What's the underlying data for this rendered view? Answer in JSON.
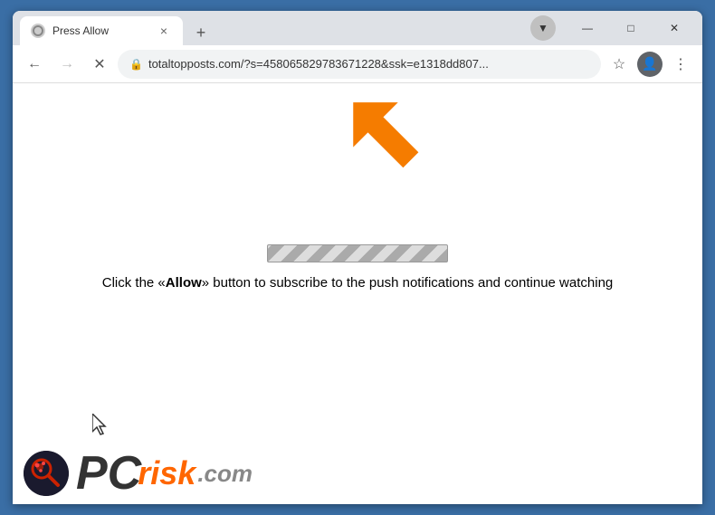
{
  "browser": {
    "title": "Press Allow",
    "url": "totaltopposts.com/?s=458065829783671228&ssk=e1318dd807...",
    "url_display": "totaltopposts.com/?s=458065829783671228&ssk=e1318dd807...",
    "new_tab_label": "+",
    "window_controls": {
      "minimize": "—",
      "maximize": "□",
      "close": "✕"
    },
    "nav": {
      "back": "←",
      "forward": "→",
      "reload": "✕"
    }
  },
  "content": {
    "main_text_before": "Click the «",
    "allow_word": "Allow",
    "main_text_after": "» button to subscribe to the push notifications and continue watching"
  },
  "logo": {
    "pc": "PC",
    "risk": "risk",
    "com": ".com"
  },
  "icons": {
    "lock": "🔒",
    "star": "☆",
    "menu": "⋮",
    "downloads": "▼"
  }
}
